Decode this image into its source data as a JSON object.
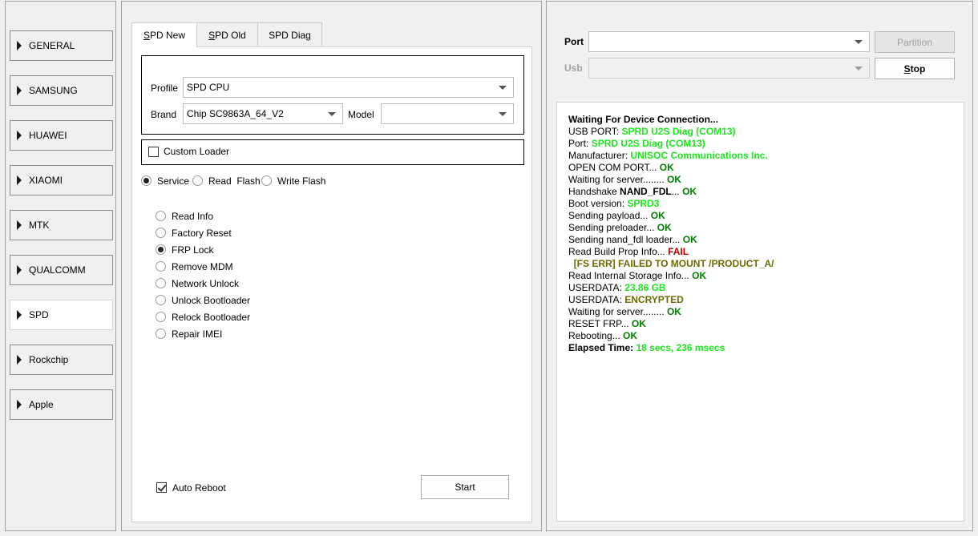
{
  "nav": {
    "items": [
      {
        "label": "GENERAL"
      },
      {
        "label": "SAMSUNG"
      },
      {
        "label": "HUAWEI"
      },
      {
        "label": "XIAOMI"
      },
      {
        "label": "MTK"
      },
      {
        "label": "QUALCOMM"
      },
      {
        "label": "SPD",
        "active": true
      },
      {
        "label": "Rockchip"
      },
      {
        "label": "Apple"
      }
    ]
  },
  "tabs": [
    {
      "label_u": "S",
      "label_rest": "PD New",
      "active": true
    },
    {
      "label_u": "S",
      "label_rest": "PD Old"
    },
    {
      "label_u": "",
      "label_rest": "SPD Diag"
    }
  ],
  "form": {
    "profile_label": "Profile",
    "profile_value": "SPD CPU",
    "brand_label": "Brand",
    "brand_value": "Chip SC9863A_64_V2",
    "model_label": "Model",
    "model_value": "",
    "custom_loader_label": "Custom Loader",
    "custom_loader_checked": false,
    "modes": [
      {
        "label": "Service",
        "checked": true
      },
      {
        "label": "Read  Flash",
        "checked": false
      },
      {
        "label": "Write Flash",
        "checked": false
      }
    ],
    "operations": [
      {
        "label": "Read Info",
        "checked": false
      },
      {
        "label": "Factory Reset",
        "checked": false
      },
      {
        "label": "FRP Lock",
        "checked": true
      },
      {
        "label": "Remove MDM",
        "checked": false
      },
      {
        "label": "Network Unlock",
        "checked": false
      },
      {
        "label": "Unlock Bootloader",
        "checked": false
      },
      {
        "label": "Relock Bootloader",
        "checked": false
      },
      {
        "label": "Repair IMEI",
        "checked": false
      }
    ],
    "auto_reboot_label": "Auto Reboot",
    "auto_reboot_checked": true,
    "start_label": "Start"
  },
  "right": {
    "port_label": "Port",
    "port_value": "",
    "usb_label": "Usb",
    "usb_value": "",
    "partition_label": "Partition",
    "stop_u": "S",
    "stop_rest": "top"
  },
  "log": [
    [
      {
        "t": "Waiting For Device Connection...",
        "c": "b"
      }
    ],
    [
      {
        "t": "USB PORT: ",
        "c": ""
      },
      {
        "t": "SPRD U2S Diag (COM13)",
        "c": "g"
      }
    ],
    [
      {
        "t": "Port: ",
        "c": ""
      },
      {
        "t": "SPRD U2S Diag (COM13)",
        "c": "g"
      }
    ],
    [
      {
        "t": "Manufacturer: ",
        "c": ""
      },
      {
        "t": "UNISOC Communications Inc.",
        "c": "g"
      }
    ],
    [
      {
        "t": "OPEN COM PORT... ",
        "c": ""
      },
      {
        "t": "OK",
        "c": "dg"
      }
    ],
    [
      {
        "t": "Waiting for server........ ",
        "c": ""
      },
      {
        "t": "OK",
        "c": "dg"
      }
    ],
    [
      {
        "t": "Handshake ",
        "c": ""
      },
      {
        "t": "NAND_FDL",
        "c": "b"
      },
      {
        "t": "... ",
        "c": ""
      },
      {
        "t": "OK",
        "c": "dg"
      }
    ],
    [
      {
        "t": "Boot version: ",
        "c": ""
      },
      {
        "t": "SPRD3",
        "c": "g"
      }
    ],
    [
      {
        "t": "Sending payload... ",
        "c": ""
      },
      {
        "t": "OK",
        "c": "dg"
      }
    ],
    [
      {
        "t": "Sending preloader... ",
        "c": ""
      },
      {
        "t": "OK",
        "c": "dg"
      }
    ],
    [
      {
        "t": "Sending nand_fdl loader... ",
        "c": ""
      },
      {
        "t": "OK",
        "c": "dg"
      }
    ],
    [
      {
        "t": "Read Build Prop Info... ",
        "c": ""
      },
      {
        "t": "FAIL",
        "c": "r"
      }
    ],
    [
      {
        "t": "  [FS ERR] FAILED TO MOUNT /PRODUCT_A/",
        "c": "ol"
      }
    ],
    [
      {
        "t": "Read Internal Storage Info... ",
        "c": ""
      },
      {
        "t": "OK",
        "c": "dg"
      }
    ],
    [
      {
        "t": "USERDATA: ",
        "c": ""
      },
      {
        "t": "23.86 GB",
        "c": "g"
      }
    ],
    [
      {
        "t": "USERDATA: ",
        "c": ""
      },
      {
        "t": "ENCRYPTED",
        "c": "ol"
      }
    ],
    [
      {
        "t": "Waiting for server........ ",
        "c": ""
      },
      {
        "t": "OK",
        "c": "dg"
      }
    ],
    [
      {
        "t": "RESET FRP... ",
        "c": ""
      },
      {
        "t": "OK",
        "c": "dg"
      }
    ],
    [
      {
        "t": "Rebooting... ",
        "c": ""
      },
      {
        "t": "OK",
        "c": "dg"
      }
    ],
    [
      {
        "t": "Elapsed Time: ",
        "c": "b"
      },
      {
        "t": "18 secs, 236 msecs",
        "c": "g"
      }
    ]
  ],
  "colors": {
    "ok_bright": "#1fe41f",
    "ok_dark": "#008000",
    "fail": "#b00000",
    "warn": "#6b6b00"
  }
}
